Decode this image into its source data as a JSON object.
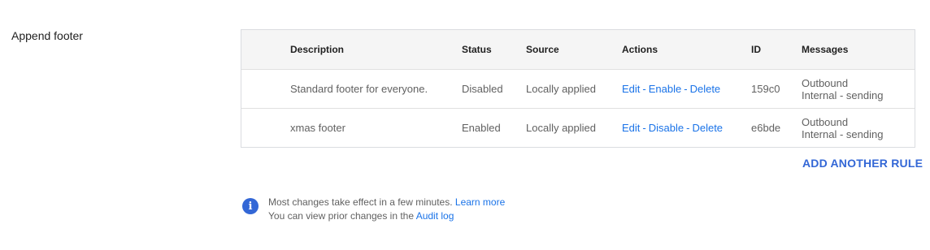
{
  "section": {
    "title": "Append footer"
  },
  "table": {
    "headers": {
      "description": "Description",
      "status": "Status",
      "source": "Source",
      "actions": "Actions",
      "id": "ID",
      "messages": "Messages"
    },
    "rows": [
      {
        "description": "Standard footer for everyone.",
        "status": "Disabled",
        "source": "Locally applied",
        "action_edit": "Edit",
        "action_toggle": "Enable",
        "action_delete": "Delete",
        "separator": "-",
        "id": "159c0",
        "messages_line1": "Outbound",
        "messages_line2": "Internal - sending"
      },
      {
        "description": "xmas footer",
        "status": "Enabled",
        "source": "Locally applied",
        "action_edit": "Edit",
        "action_toggle": "Disable",
        "action_delete": "Delete",
        "separator": "-",
        "id": "e6bde",
        "messages_line1": "Outbound",
        "messages_line2": "Internal - sending"
      }
    ]
  },
  "add_rule_label": "ADD ANOTHER RULE",
  "info": {
    "icon": "info-icon",
    "icon_glyph": "i",
    "line1_text": "Most changes take effect in a few minutes.",
    "learn_more": "Learn more",
    "line2_text": "You can view prior changes in the",
    "audit_log": "Audit log"
  },
  "colors": {
    "link": "#1a73e8",
    "accent": "#3367d6",
    "header_bg": "#f5f5f5"
  }
}
